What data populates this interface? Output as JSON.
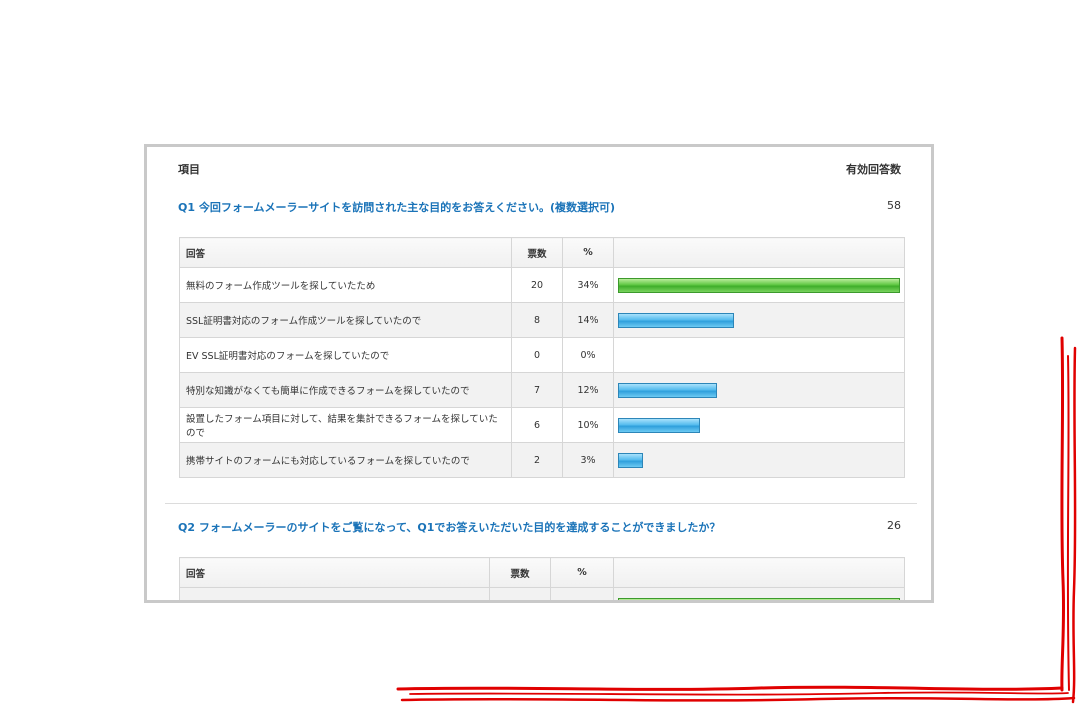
{
  "panel": {
    "item_header": "項目",
    "valid_header": "有効回答数"
  },
  "q1": {
    "title": "Q1 今回フォームメーラーサイトを訪問された主な目的をお答えください。(複数選択可)",
    "count": "58",
    "columns": {
      "answer": "回答",
      "votes": "票数",
      "pct": "%"
    },
    "rows": [
      {
        "answer": "無料のフォーム作成ツールを探していたため",
        "votes": "20",
        "pct": "34%",
        "ratio": 1.0,
        "top": true
      },
      {
        "answer": "SSL証明書対応のフォーム作成ツールを探していたので",
        "votes": "8",
        "pct": "14%",
        "ratio": 0.41,
        "top": false
      },
      {
        "answer": "EV SSL証明書対応のフォームを探していたので",
        "votes": "0",
        "pct": "0%",
        "ratio": 0,
        "top": false
      },
      {
        "answer": "特別な知識がなくても簡単に作成できるフォームを探していたので",
        "votes": "7",
        "pct": "12%",
        "ratio": 0.35,
        "top": false
      },
      {
        "answer": "設置したフォーム項目に対して、結果を集計できるフォームを探していたので",
        "votes": "6",
        "pct": "10%",
        "ratio": 0.29,
        "top": false
      },
      {
        "answer": "携帯サイトのフォームにも対応しているフォームを探していたので",
        "votes": "2",
        "pct": "3%",
        "ratio": 0.09,
        "top": false
      }
    ]
  },
  "q2": {
    "title": "Q2 フォームメーラーのサイトをご覧になって、Q1でお答えいただいた目的を達成することができましたか？",
    "count": "26",
    "columns": {
      "answer": "回答",
      "votes": "票数",
      "pct": "%"
    }
  },
  "colors": {
    "title_blue": "#1a73b8",
    "bar_blue": "#3aa7e0",
    "bar_green": "#4cbf35",
    "scribble_red": "#e00000",
    "frame": "#c9c9c9"
  }
}
